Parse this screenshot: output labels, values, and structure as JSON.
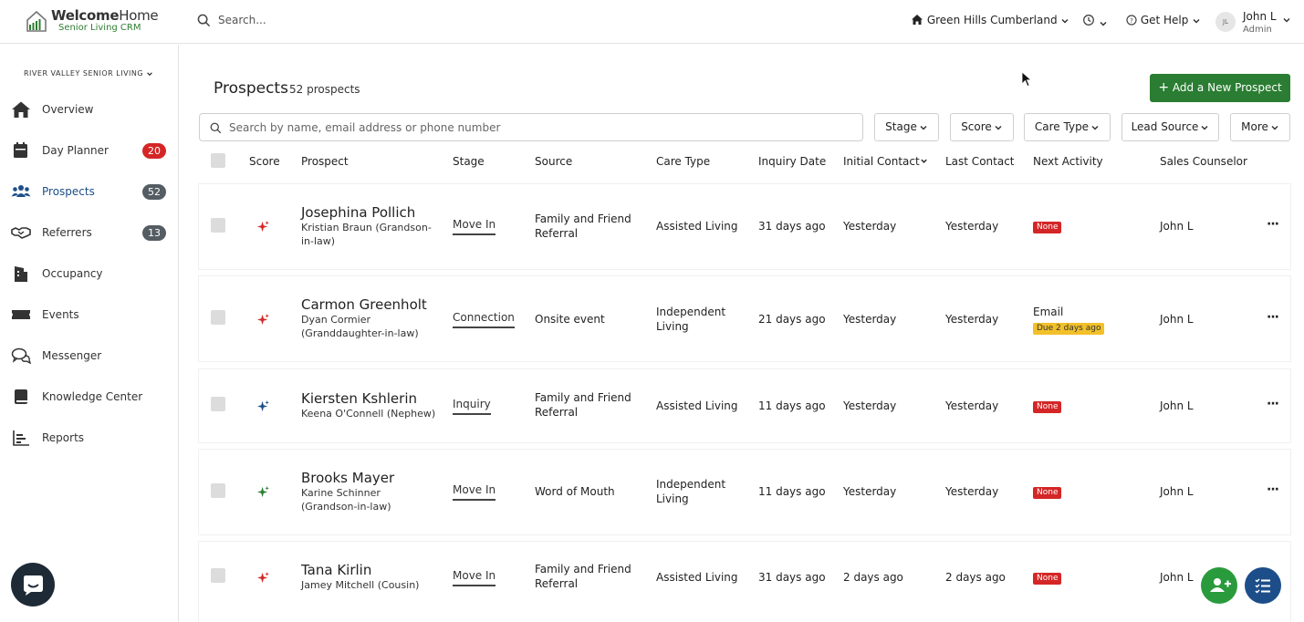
{
  "app": {
    "brand_bold": "Welcome",
    "brand_light": "Home",
    "tagline": "Senior Living CRM"
  },
  "topbar": {
    "search_placeholder": "Search...",
    "community": "Green Hills Cumberland",
    "help": "Get Help",
    "user_initials": "JL",
    "user_name": "John L",
    "user_role": "Admin"
  },
  "sidebar": {
    "org": "RIVER VALLEY SENIOR LIVING",
    "items": [
      {
        "label": "Overview",
        "icon": "home-icon",
        "badge": ""
      },
      {
        "label": "Day Planner",
        "icon": "calendar-icon",
        "badge": "20"
      },
      {
        "label": "Prospects",
        "icon": "people-icon",
        "badge": "52"
      },
      {
        "label": "Referrers",
        "icon": "handshake-icon",
        "badge": "13"
      },
      {
        "label": "Occupancy",
        "icon": "building-icon",
        "badge": ""
      },
      {
        "label": "Events",
        "icon": "ticket-icon",
        "badge": ""
      },
      {
        "label": "Messenger",
        "icon": "chat-icon",
        "badge": ""
      },
      {
        "label": "Knowledge Center",
        "icon": "book-icon",
        "badge": ""
      },
      {
        "label": "Reports",
        "icon": "bar-chart-icon",
        "badge": ""
      }
    ]
  },
  "main": {
    "title": "Prospects",
    "count": "52 prospects",
    "add_button": "Add a New Prospect",
    "search_placeholder": "Search by name, email address or phone number",
    "filters": [
      "Stage",
      "Score",
      "Care Type",
      "Lead Source",
      "More"
    ]
  },
  "table": {
    "headers": [
      "Score",
      "Prospect",
      "Stage",
      "Source",
      "Care Type",
      "Inquiry Date",
      "Initial Contact",
      "Last Contact",
      "Next Activity",
      "Sales Counselor"
    ],
    "rows": [
      {
        "name": "Josephina Pollich",
        "contact": "Kristian Braun (Grandson-in-law)",
        "stage": "Move In",
        "source": "Family and Friend Referral",
        "care_type": "Assisted Living",
        "inquiry": "31 days ago",
        "initial": "Yesterday",
        "last": "Yesterday",
        "next": "",
        "next_badge": "None",
        "counselor": "John L",
        "score_color": "#d42626"
      },
      {
        "name": "Carmon Greenholt",
        "contact": "Dyan Cormier (Granddaughter-in-law)",
        "stage": "Connection",
        "source": "Onsite event",
        "care_type": "Independent Living",
        "inquiry": "21 days ago",
        "initial": "Yesterday",
        "last": "Yesterday",
        "next": "Email",
        "next_badge": "Due 2 days ago",
        "counselor": "John L",
        "score_color": "#d42626"
      },
      {
        "name": "Kiersten Kshlerin",
        "contact": "Keena O'Connell (Nephew)",
        "stage": "Inquiry",
        "source": "Family and Friend Referral",
        "care_type": "Assisted Living",
        "inquiry": "11 days ago",
        "initial": "Yesterday",
        "last": "Yesterday",
        "next": "",
        "next_badge": "None",
        "counselor": "John L",
        "score_color": "#1d4e89"
      },
      {
        "name": "Brooks Mayer",
        "contact": "Karine Schinner (Grandson-in-law)",
        "stage": "Move In",
        "source": "Word of Mouth",
        "care_type": "Independent Living",
        "inquiry": "11 days ago",
        "initial": "Yesterday",
        "last": "Yesterday",
        "next": "",
        "next_badge": "None",
        "counselor": "John L",
        "score_color": "#2a7d32"
      },
      {
        "name": "Tana Kirlin",
        "contact": "Jamey Mitchell (Cousin)",
        "stage": "Move In",
        "source": "Family and Friend Referral",
        "care_type": "Assisted Living",
        "inquiry": "31 days ago",
        "initial": "2 days ago",
        "last": "2 days ago",
        "next": "",
        "next_badge": "None",
        "counselor": "John L",
        "score_color": "#d42626"
      }
    ]
  },
  "colors": {
    "primary_green": "#2a7d32",
    "navy": "#1d4e89",
    "danger": "#d42626",
    "warning": "#f2c029"
  }
}
